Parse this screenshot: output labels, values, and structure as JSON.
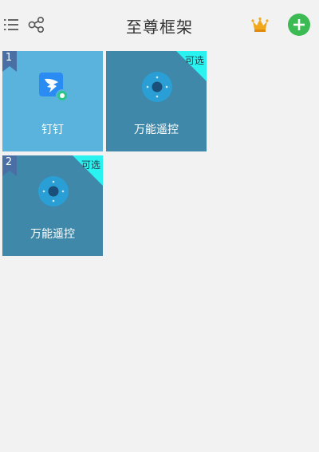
{
  "header": {
    "title": "至尊框架",
    "icons": [
      "list-icon",
      "share-icon",
      "crown-icon",
      "add-icon"
    ]
  },
  "colors": {
    "background": "#f2f2f2",
    "tile_selected": "#5ab3dd",
    "tile_default": "#3f88aa",
    "optional_badge": "#29f2f0",
    "ribbon": "#4a6fa5",
    "add_button": "#3cba54",
    "crown": "#f2a81d"
  },
  "tiles": [
    {
      "index": "1",
      "label": "钉钉",
      "icon": "dingtalk-icon",
      "selected": true,
      "optional_badge": ""
    },
    {
      "index": "",
      "label": "万能遥控",
      "icon": "remote-control-icon",
      "selected": false,
      "optional_badge": "可选"
    },
    {
      "index": "2",
      "label": "万能遥控",
      "icon": "remote-control-icon",
      "selected": false,
      "optional_badge": "可选"
    }
  ]
}
